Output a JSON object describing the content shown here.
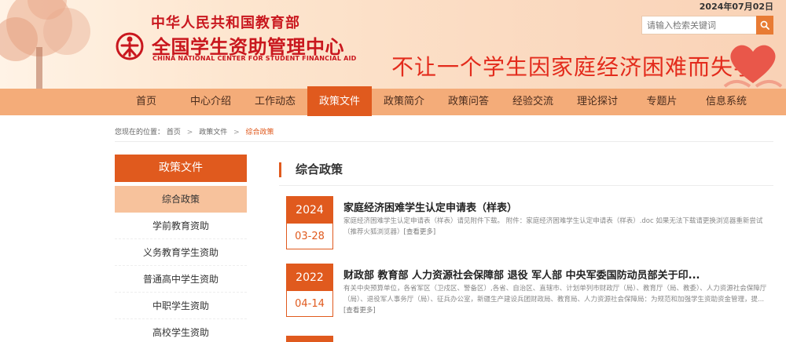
{
  "header": {
    "gov_name": "中华人民共和国教育部",
    "center_name": "全国学生资助管理中心",
    "center_name_en": "CHINA NATIONAL CENTER FOR STUDENT FINANCIAL AID",
    "slogan": "不让一个学生因家庭经济困难而失学",
    "date": "2024年07月02日"
  },
  "search": {
    "placeholder": "请输入检索关键词",
    "button_icon": "search-icon"
  },
  "nav": {
    "items": [
      {
        "label": "首页"
      },
      {
        "label": "中心介绍"
      },
      {
        "label": "工作动态"
      },
      {
        "label": "政策文件",
        "active": true
      },
      {
        "label": "政策简介"
      },
      {
        "label": "政策问答"
      },
      {
        "label": "经验交流"
      },
      {
        "label": "理论探讨"
      },
      {
        "label": "专题片"
      },
      {
        "label": "信息系统"
      }
    ]
  },
  "breadcrumb": {
    "prefix": "您现在的位置：",
    "items": [
      "首页",
      "政策文件",
      "综合政策"
    ],
    "separator": ">"
  },
  "sidebar": {
    "title": "政策文件",
    "items": [
      {
        "label": "综合政策",
        "active": true
      },
      {
        "label": "学前教育资助"
      },
      {
        "label": "义务教育学生资助"
      },
      {
        "label": "普通高中学生资助"
      },
      {
        "label": "中职学生资助"
      },
      {
        "label": "高校学生资助"
      }
    ]
  },
  "main": {
    "title": "综合政策",
    "articles": [
      {
        "year": "2024",
        "md": "03-28",
        "title": "家庭经济困难学生认定申请表（样表）",
        "summary": "家庭经济困难学生认定申请表（样表）请见附件下载。 附件：家庭经济困难学生认定申请表（样表）.doc 如果无法下载请更换浏览器重新尝试（推荐火狐浏览器）",
        "more": "[查看更多]"
      },
      {
        "year": "2022",
        "md": "04-14",
        "title": "财政部 教育部 人力资源社会保障部 退役 军人部 中央军委国防动员部关于印...",
        "summary": "有关中央预算单位，各省军区（卫戍区、警备区）,各省、自治区、直辖市、计划单列市财政厅（局）、教育厅（局、教委）、人力资源社会保障厅（局）、退役军人事务厅（局）、征兵办公室，新疆生产建设兵团财政局、教育局、人力资源社会保障局：为规范和加强学生资助资金管理，提...",
        "more": "[查看更多]"
      }
    ]
  },
  "colors": {
    "brand_red": "#c9171e",
    "accent_orange": "#e05a1e",
    "nav_bg": "#f4ac79",
    "sidebar_active": "#f7c29c"
  }
}
